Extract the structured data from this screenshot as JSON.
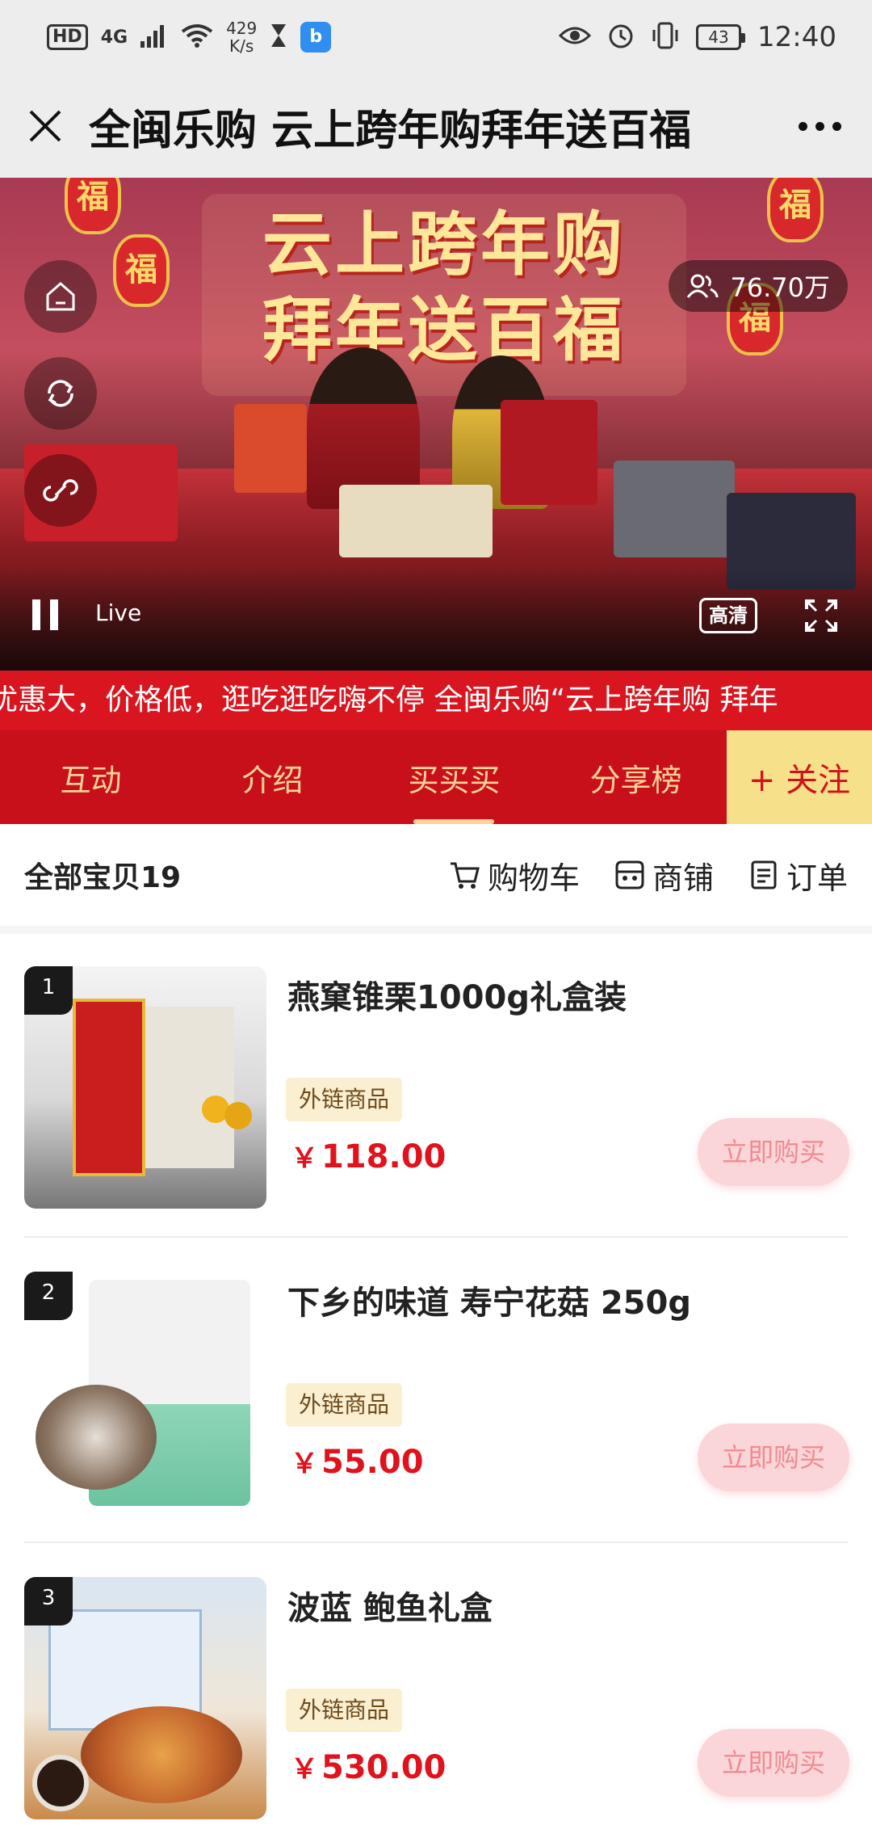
{
  "status_bar": {
    "hd": "HD",
    "network": "4G",
    "speed_value": "429",
    "speed_unit": "K/s",
    "battery": "43",
    "time": "12:40"
  },
  "title_bar": {
    "title": "全闽乐购 云上跨年购拜年送百福"
  },
  "video": {
    "headline_line1": "云上跨年购",
    "headline_line2": "拜年送百福",
    "lantern_char": "福",
    "viewers": "76.70万",
    "live_label": "Live",
    "quality_label": "高清"
  },
  "marquee": {
    "text": "优惠大，价格低，逛吃逛吃嗨不停 全闽乐购“云上跨年购 拜年"
  },
  "tabs": {
    "items": [
      "互动",
      "介绍",
      "买买买",
      "分享榜"
    ],
    "active_index": 2,
    "follow_label": "+ 关注"
  },
  "shop_bar": {
    "all_items": "全部宝贝19",
    "cart": "购物车",
    "store": "商铺",
    "orders": "订单"
  },
  "products": [
    {
      "rank": "1",
      "name": "燕窠锥栗1000g礼盒装",
      "tag": "外链商品",
      "currency": "￥",
      "price": "118.00",
      "buy_label": "立即购买"
    },
    {
      "rank": "2",
      "name": "下乡的味道 寿宁花菇 250g",
      "tag": "外链商品",
      "currency": "￥",
      "price": "55.00",
      "buy_label": "立即购买"
    },
    {
      "rank": "3",
      "name": "波蓝 鲍鱼礼盒",
      "tag": "外链商品",
      "currency": "￥",
      "price": "530.00",
      "buy_label": "立即购买"
    }
  ],
  "colors": {
    "brand_red": "#c8101a",
    "marquee_red": "#d9161f",
    "tab_text": "#ffd39a",
    "follow_bg": "#f6e08a",
    "price_red": "#e0121c"
  }
}
